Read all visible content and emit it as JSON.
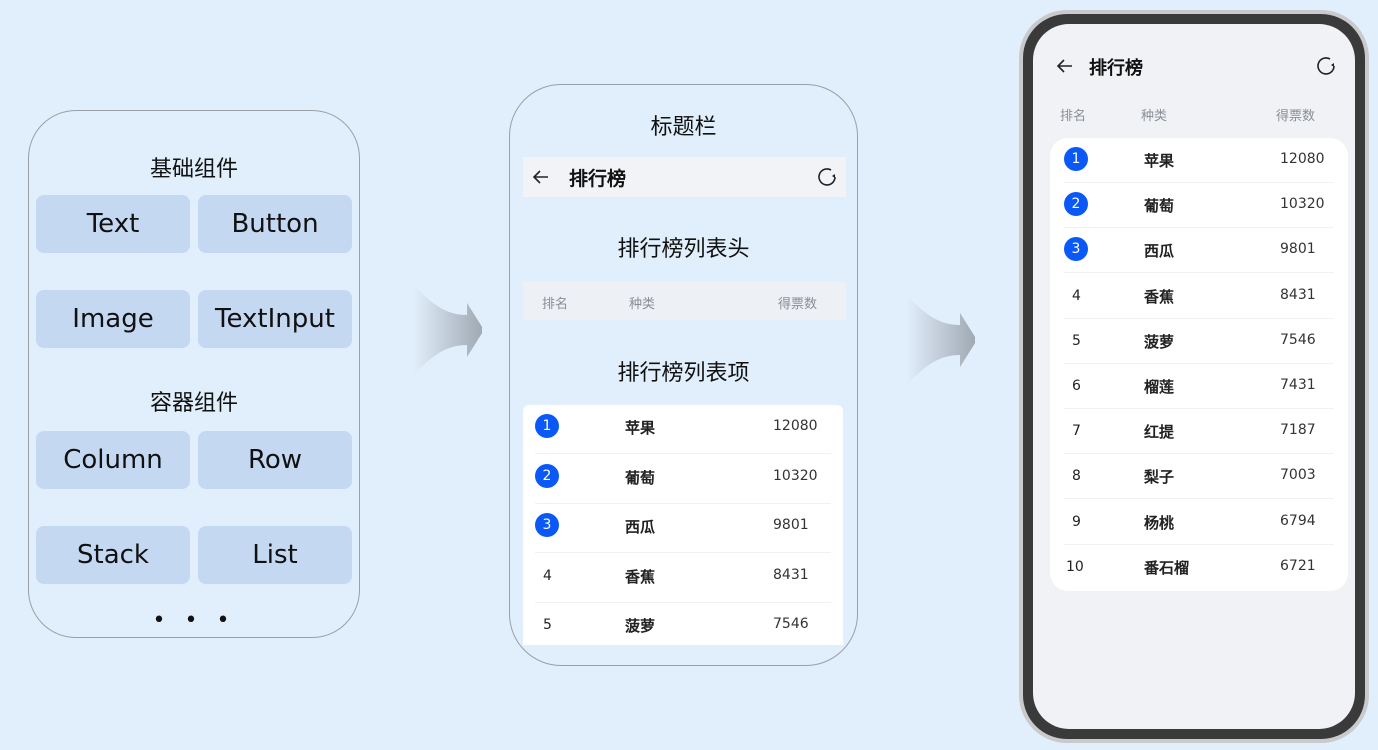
{
  "panel_components": {
    "basic_title": "基础组件",
    "basic_items": [
      "Text",
      "Button",
      "Image",
      "TextInput"
    ],
    "container_title": "容器组件",
    "container_items": [
      "Column",
      "Row",
      "Stack",
      "List"
    ],
    "more": "• • •"
  },
  "panel_breakdown": {
    "titlebar_label": "标题栏",
    "titlebar": {
      "back_icon": "arrow-left-icon",
      "title": "排行榜",
      "refresh_icon": "refresh-icon"
    },
    "header_label": "排行榜列表头",
    "header": [
      "排名",
      "种类",
      "得票数"
    ],
    "items_label": "排行榜列表项",
    "items": [
      {
        "rank": "1",
        "name": "苹果",
        "votes": "12080"
      },
      {
        "rank": "2",
        "name": "葡萄",
        "votes": "10320"
      },
      {
        "rank": "3",
        "name": "西瓜",
        "votes": "9801"
      },
      {
        "rank": "4",
        "name": "香蕉",
        "votes": "8431"
      },
      {
        "rank": "5",
        "name": "菠萝",
        "votes": "7546"
      }
    ]
  },
  "phone": {
    "title": "排行榜",
    "header": [
      "排名",
      "种类",
      "得票数"
    ],
    "items": [
      {
        "rank": "1",
        "name": "苹果",
        "votes": "12080"
      },
      {
        "rank": "2",
        "name": "葡萄",
        "votes": "10320"
      },
      {
        "rank": "3",
        "name": "西瓜",
        "votes": "9801"
      },
      {
        "rank": "4",
        "name": "香蕉",
        "votes": "8431"
      },
      {
        "rank": "5",
        "name": "菠萝",
        "votes": "7546"
      },
      {
        "rank": "6",
        "name": "榴莲",
        "votes": "7431"
      },
      {
        "rank": "7",
        "name": "红提",
        "votes": "7187"
      },
      {
        "rank": "8",
        "name": "梨子",
        "votes": "7003"
      },
      {
        "rank": "9",
        "name": "杨桃",
        "votes": "6794"
      },
      {
        "rank": "10",
        "name": "番石榴",
        "votes": "6721"
      }
    ]
  },
  "colors": {
    "accent": "#0a59f7",
    "background": "#e1eefb",
    "chip": "#c4d8f2"
  }
}
